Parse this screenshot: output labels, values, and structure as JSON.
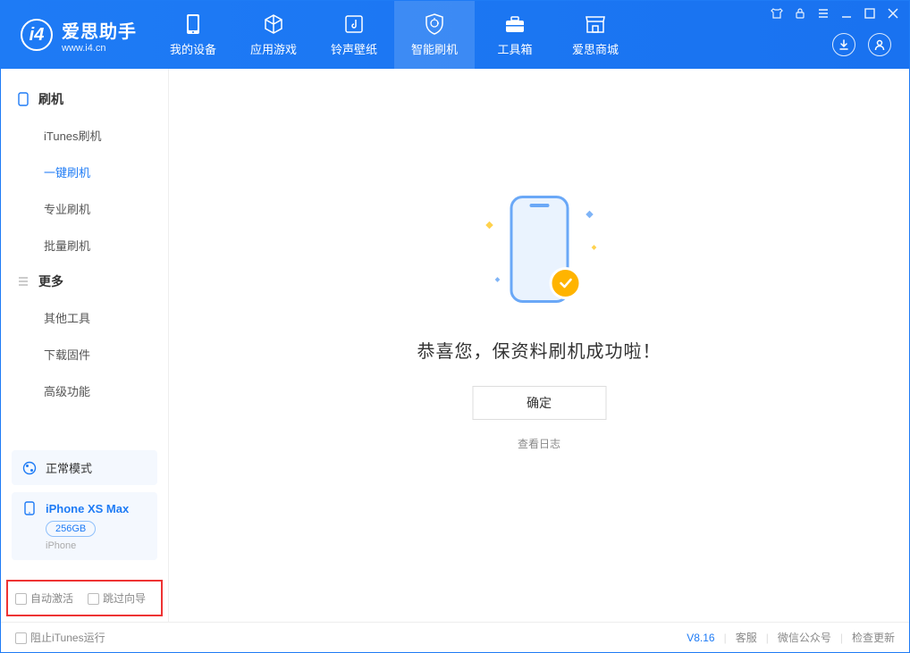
{
  "app": {
    "title": "爱思助手",
    "subtitle": "www.i4.cn"
  },
  "nav": {
    "tabs": [
      {
        "label": "我的设备"
      },
      {
        "label": "应用游戏"
      },
      {
        "label": "铃声壁纸"
      },
      {
        "label": "智能刷机"
      },
      {
        "label": "工具箱"
      },
      {
        "label": "爱思商城"
      }
    ]
  },
  "sidebar": {
    "group_flash": {
      "label": "刷机",
      "items": [
        {
          "label": "iTunes刷机"
        },
        {
          "label": "一键刷机"
        },
        {
          "label": "专业刷机"
        },
        {
          "label": "批量刷机"
        }
      ]
    },
    "group_more": {
      "label": "更多",
      "items": [
        {
          "label": "其他工具"
        },
        {
          "label": "下载固件"
        },
        {
          "label": "高级功能"
        }
      ]
    },
    "mode_label": "正常模式",
    "device": {
      "name": "iPhone XS Max",
      "storage": "256GB",
      "type": "iPhone"
    },
    "options": {
      "auto_activate": "自动激活",
      "skip_guide": "跳过向导"
    }
  },
  "main": {
    "success_text": "恭喜您，保资料刷机成功啦！",
    "ok_label": "确定",
    "log_link": "查看日志"
  },
  "footer": {
    "block_itunes": "阻止iTunes运行",
    "version": "V8.16",
    "support": "客服",
    "wechat": "微信公众号",
    "update": "检查更新"
  }
}
